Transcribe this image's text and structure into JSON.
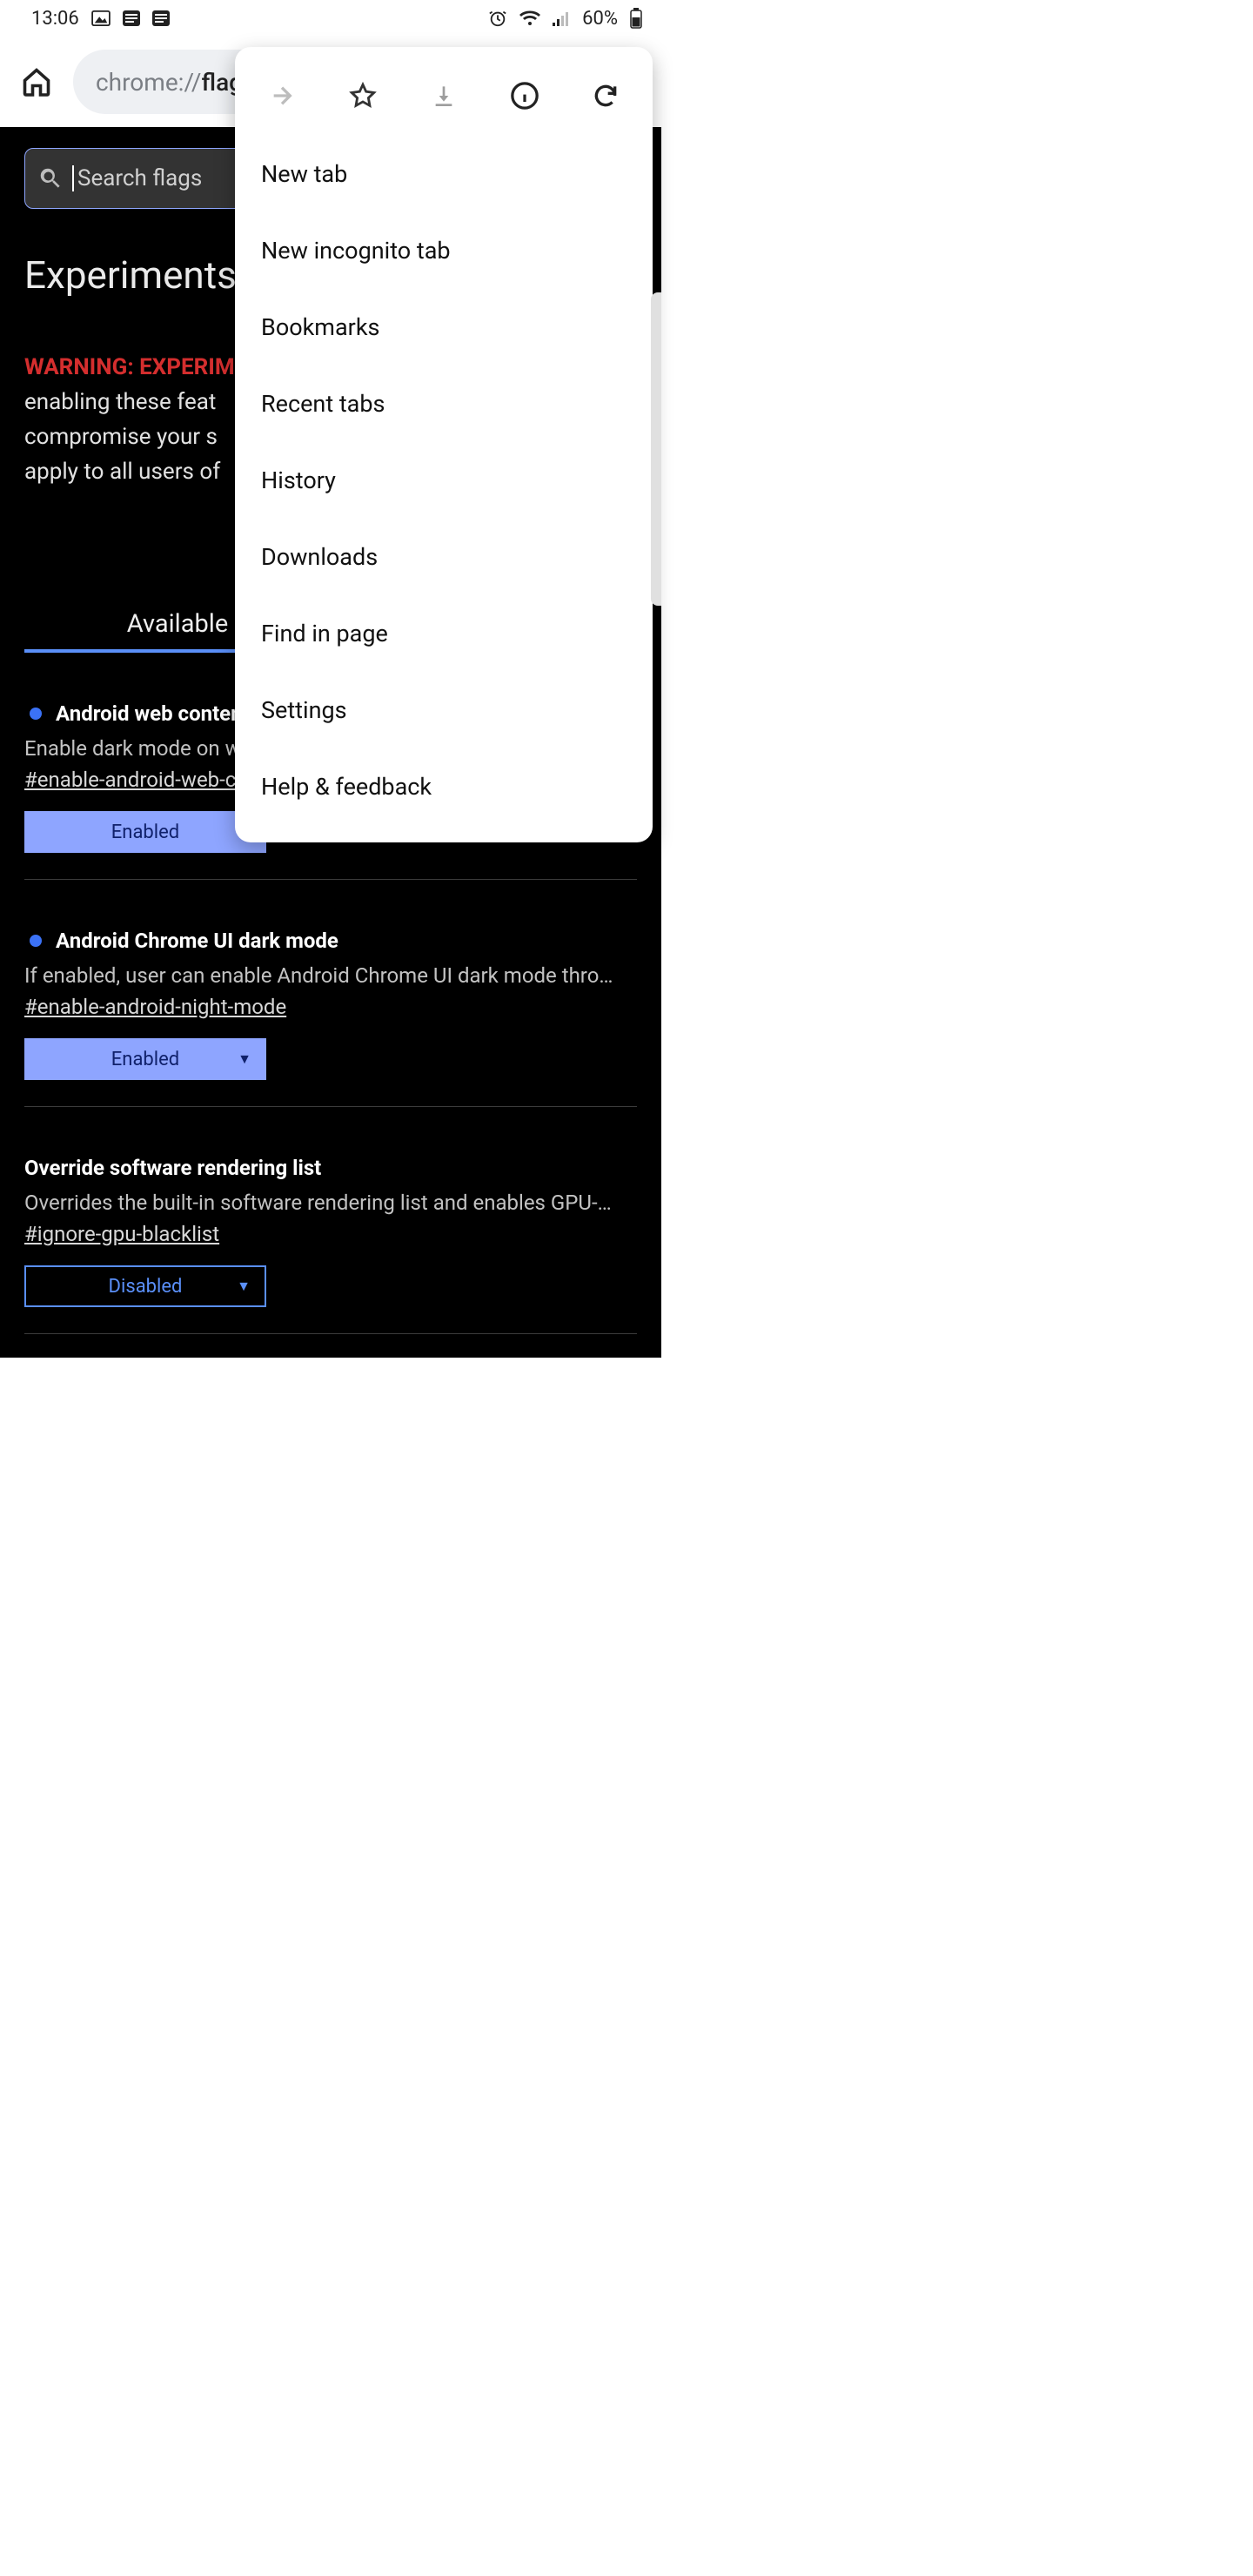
{
  "status": {
    "time": "13:06",
    "battery": "60%"
  },
  "browser": {
    "url_prefix": "chrome://",
    "url_rest": "flags"
  },
  "menu": {
    "items": [
      "New tab",
      "New incognito tab",
      "Bookmarks",
      "Recent tabs",
      "History",
      "Downloads",
      "Find in page",
      "Settings",
      "Help & feedback"
    ]
  },
  "page": {
    "search_placeholder": "Search flags",
    "title": "Experiments",
    "warning_label": "WARNING: EXPERIM",
    "body": "enabling these feat compromise your s apply to all users of",
    "tabs": {
      "available": "Available",
      "unavailable": ""
    },
    "flags": [
      {
        "title": "Android web conten",
        "desc": "Enable dark mode on w",
        "hash": "#enable-android-web-contents-dark-mode",
        "state": "Enabled",
        "has_dot": true
      },
      {
        "title": "Android Chrome UI dark mode",
        "desc": "If enabled, user can enable Android Chrome UI dark mode thro…",
        "hash": "#enable-android-night-mode",
        "state": "Enabled",
        "has_dot": true
      },
      {
        "title": "Override software rendering list",
        "desc": "Overrides the built-in software rendering list and enables GPU-…",
        "hash": "#ignore-gpu-blacklist",
        "state": "Disabled",
        "has_dot": false
      }
    ]
  }
}
